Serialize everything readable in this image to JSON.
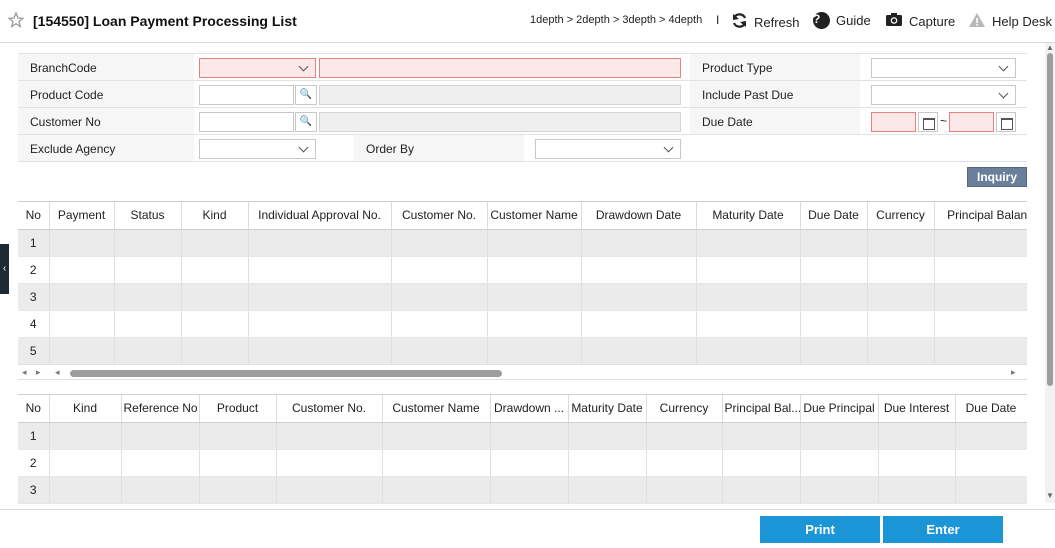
{
  "header": {
    "title": "[154550] Loan Payment Processing List",
    "breadcrumb": "1depth > 2depth > 3depth > 4depth",
    "separator": "I",
    "refresh_label": "Refresh",
    "guide_label": "Guide",
    "capture_label": "Capture",
    "helpdesk_label": "Help Desk"
  },
  "form": {
    "branch_code_label": "BranchCode",
    "product_code_label": "Product Code",
    "customer_no_label": "Customer No",
    "exclude_agency_label": "Exclude Agency",
    "order_by_label": "Order By",
    "product_type_label": "Product Type",
    "include_past_due_label": "Include Past Due",
    "due_date_label": "Due Date",
    "search_glyph": "🔍",
    "tilde": "~"
  },
  "inquiry_label": "Inquiry",
  "grid1": {
    "columns": [
      "No",
      "Payment",
      "Status",
      "Kind",
      "Individual Approval No.",
      "Customer No.",
      "Customer Name",
      "Drawdown Date",
      "Maturity Date",
      "Due Date",
      "Currency",
      "Principal Balance"
    ],
    "rows": [
      "1",
      "2",
      "3",
      "4",
      "5"
    ]
  },
  "grid2": {
    "columns": [
      "No",
      "Kind",
      "Reference No",
      "Product",
      "Customer No.",
      "Customer Name",
      "Drawdown ...",
      "Maturity Date",
      "Currency",
      "Principal Bal...",
      "Due Principal",
      "Due Interest",
      "Due Date"
    ],
    "rows": [
      "1",
      "2",
      "3"
    ]
  },
  "footer": {
    "print_label": "Print",
    "enter_label": "Enter"
  },
  "icons": {
    "star": "star-icon",
    "refresh": "refresh-icon",
    "guide": "help-circle-icon",
    "capture": "camera-icon",
    "helpdesk": "warning-triangle-icon"
  },
  "colors": {
    "required_field": "#fde8e8",
    "inquiry_button": "#6a7f9a",
    "primary_button": "#1b95d6"
  }
}
